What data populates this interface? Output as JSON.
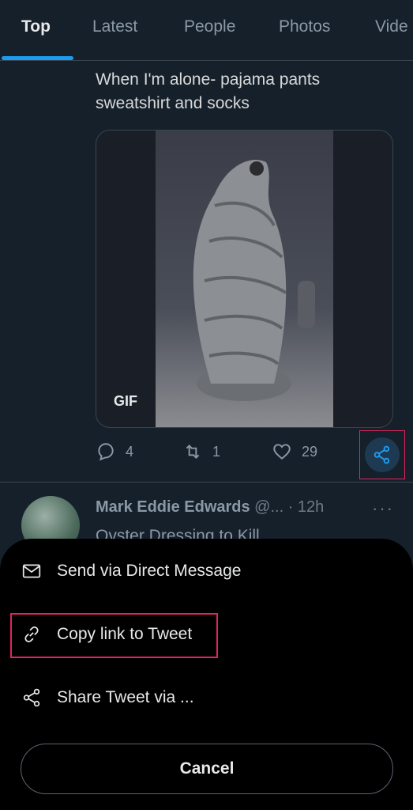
{
  "tabs": [
    {
      "label": "Top",
      "active": true
    },
    {
      "label": "Latest",
      "active": false
    },
    {
      "label": "People",
      "active": false
    },
    {
      "label": "Photos",
      "active": false
    },
    {
      "label": "Vide",
      "active": false
    }
  ],
  "tweet1": {
    "text": "When I'm alone- pajama pants sweatshirt and socks",
    "media_badge": "GIF",
    "replies": "4",
    "retweets": "1",
    "likes": "29"
  },
  "tweet2": {
    "author": "Mark Eddie Edwards",
    "handle_time": " @... · 12h",
    "more": "···",
    "text": "Oyster Dressing to Kill"
  },
  "share_sheet": {
    "items": [
      {
        "label": "Send via Direct Message",
        "icon": "mail-icon"
      },
      {
        "label": "Copy link to Tweet",
        "icon": "link-icon"
      },
      {
        "label": "Share Tweet via ...",
        "icon": "share-icon"
      }
    ],
    "cancel_label": "Cancel"
  },
  "colors": {
    "background": "#15202b",
    "accent": "#1d9bf0",
    "highlight_box": "#e0245e",
    "sheet_bg": "#000000"
  }
}
